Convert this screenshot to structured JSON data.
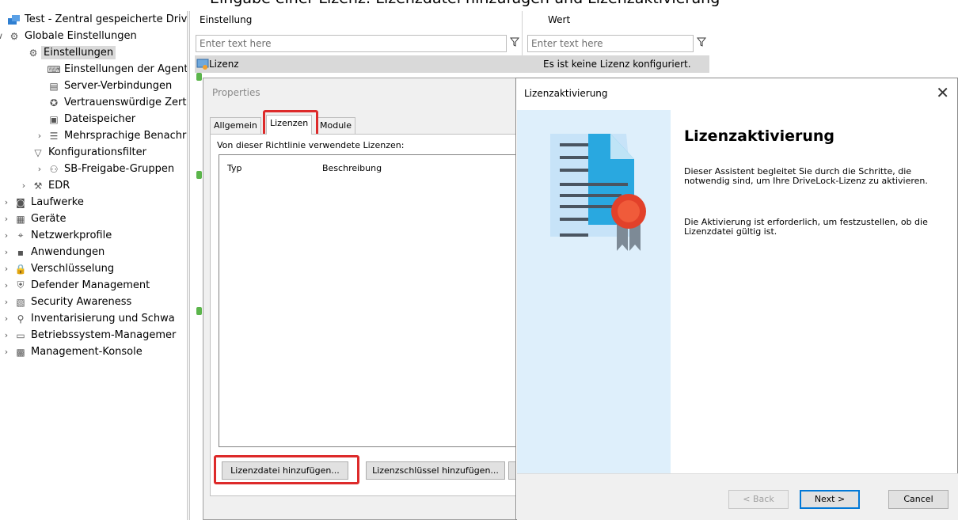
{
  "top_caption": "Eingabe einer Lizenz: Lizenzdatei hinzufügen und Lizenzaktivierung",
  "tree": {
    "root": "Test - Zentral gespeicherte Drive",
    "items": [
      {
        "label": "Globale Einstellungen",
        "icon": "gear-icon",
        "expander": "∨"
      },
      {
        "label": "Einstellungen",
        "icon": "gear-icon",
        "expander": ""
      },
      {
        "label": "Einstellungen der Agente",
        "icon": "keyboard-icon",
        "expander": ""
      },
      {
        "label": "Server-Verbindungen",
        "icon": "server-icon",
        "expander": ""
      },
      {
        "label": "Vertrauenswürdige Zertif",
        "icon": "certificate-icon",
        "expander": ""
      },
      {
        "label": "Dateispeicher",
        "icon": "storage-icon",
        "expander": ""
      },
      {
        "label": "Mehrsprachige Benachri",
        "icon": "message-icon",
        "expander": "›"
      },
      {
        "label": "Konfigurationsfilter",
        "icon": "filter-icon",
        "expander": ""
      },
      {
        "label": "SB-Freigabe-Gruppen",
        "icon": "group-icon",
        "expander": "›"
      },
      {
        "label": "EDR",
        "icon": "tools-icon",
        "expander": "›"
      },
      {
        "label": "Laufwerke",
        "icon": "drive-icon",
        "expander": "›"
      },
      {
        "label": "Geräte",
        "icon": "device-icon",
        "expander": "›"
      },
      {
        "label": "Netzwerkprofile",
        "icon": "network-icon",
        "expander": "›"
      },
      {
        "label": "Anwendungen",
        "icon": "app-icon",
        "expander": "›"
      },
      {
        "label": "Verschlüsselung",
        "icon": "lock-icon",
        "expander": "›"
      },
      {
        "label": "Defender Management",
        "icon": "shield-icon",
        "expander": "›"
      },
      {
        "label": "Security Awareness",
        "icon": "awareness-icon",
        "expander": "›"
      },
      {
        "label": "Inventarisierung und Schwa",
        "icon": "inventory-icon",
        "expander": "›"
      },
      {
        "label": "Betriebssystem-Managemer",
        "icon": "monitor-icon",
        "expander": "›"
      },
      {
        "label": "Management-Konsole",
        "icon": "console-icon",
        "expander": "›"
      }
    ]
  },
  "grid": {
    "col_setting": "Einstellung",
    "col_value": "Wert",
    "filter_placeholder": "Enter text here",
    "selected_row": {
      "setting": "Lizenz",
      "value": "Es ist keine Lizenz konfiguriert."
    }
  },
  "properties": {
    "title": "Properties",
    "tabs": [
      "Allgemein",
      "Lizenzen",
      "Module"
    ],
    "panel_label": "Von dieser Richtlinie verwendete Lizenzen:",
    "columns": [
      "Typ",
      "Beschreibung"
    ],
    "buttons": {
      "add_file": "Lizenzdatei hinzufügen...",
      "add_key": "Lizenzschlüssel hinzufügen..."
    }
  },
  "wizard": {
    "title": "Lizenzaktivierung",
    "heading": "Lizenzaktivierung",
    "paragraph1": "Dieser Assistent begleitet Sie durch die Schritte, die notwendig sind, um Ihre DriveLock-Lizenz zu aktivieren.",
    "paragraph2": "Die Aktivierung ist erforderlich, um festzustellen, ob die Lizenzdatei gültig ist.",
    "buttons": {
      "back": "< Back",
      "next": "Next >",
      "cancel": "Cancel"
    }
  },
  "colors": {
    "highlight": "#dd2a2a",
    "accent": "#0078d7",
    "side_panel": "#deeffb"
  }
}
